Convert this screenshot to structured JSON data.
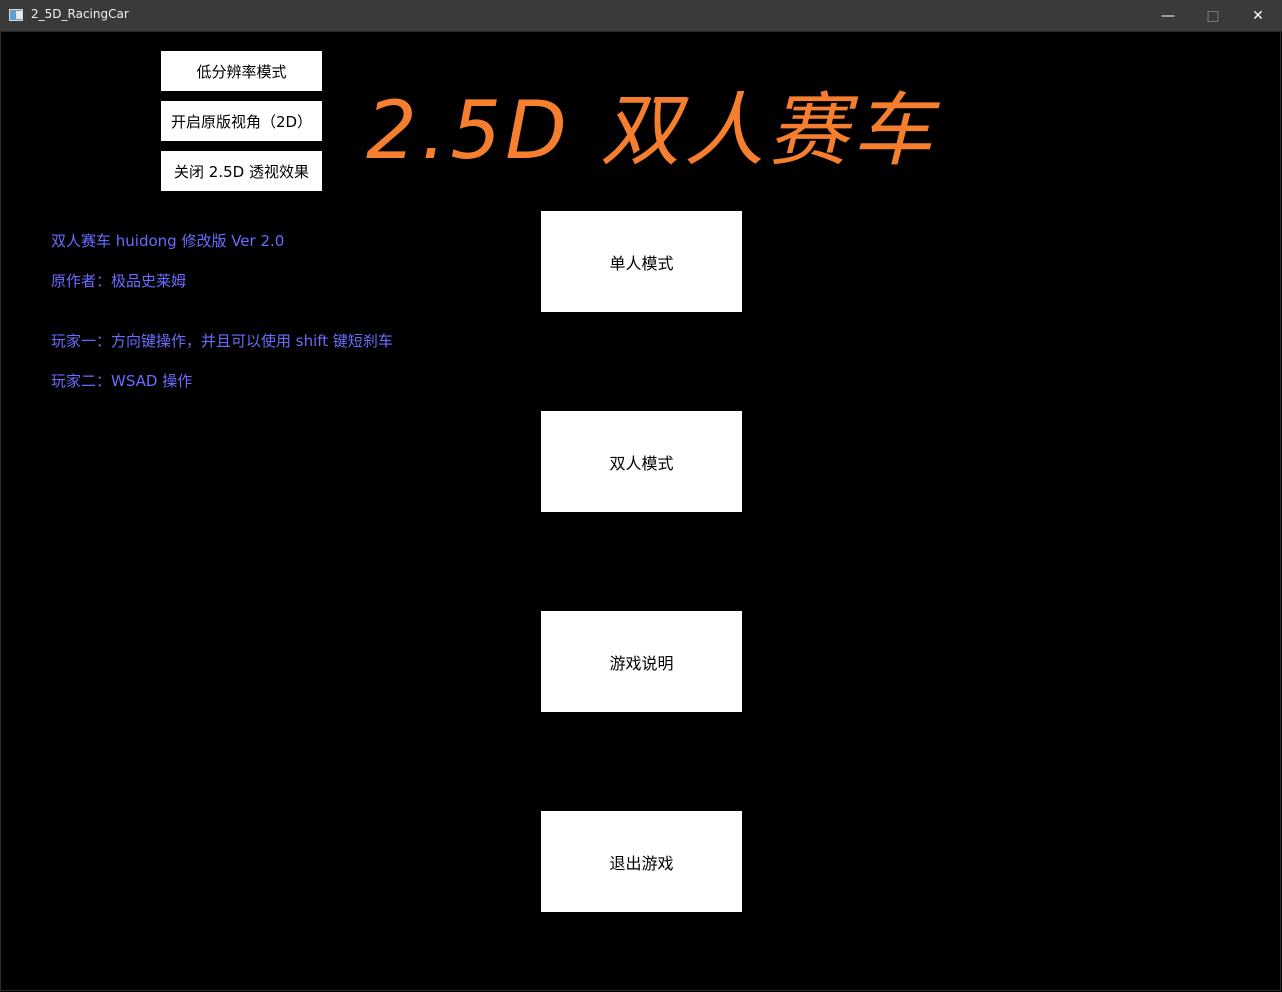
{
  "window": {
    "title": "2_5D_RacingCar",
    "min_icon": "minimize-icon",
    "max_icon": "maximize-icon",
    "close_icon": "close-icon"
  },
  "options": {
    "low_res": "低分辨率模式",
    "original_view": "开启原版视角（2D）",
    "disable_perspective": "关闭 2.5D 透视效果"
  },
  "title": "2.5D 双人赛车",
  "info": {
    "version": "双人赛车  huidong 修改版 Ver 2.0",
    "author": "原作者：极品史莱姆",
    "player1": "玩家一：方向键操作，并且可以使用 shift 键短刹车",
    "player2": "玩家二：WSAD 操作"
  },
  "menu": {
    "single": "单人模式",
    "double": "双人模式",
    "help": "游戏说明",
    "exit": "退出游戏"
  },
  "colors": {
    "title": "#f57f2e",
    "info_text": "#6b6bff",
    "background": "#000000"
  }
}
